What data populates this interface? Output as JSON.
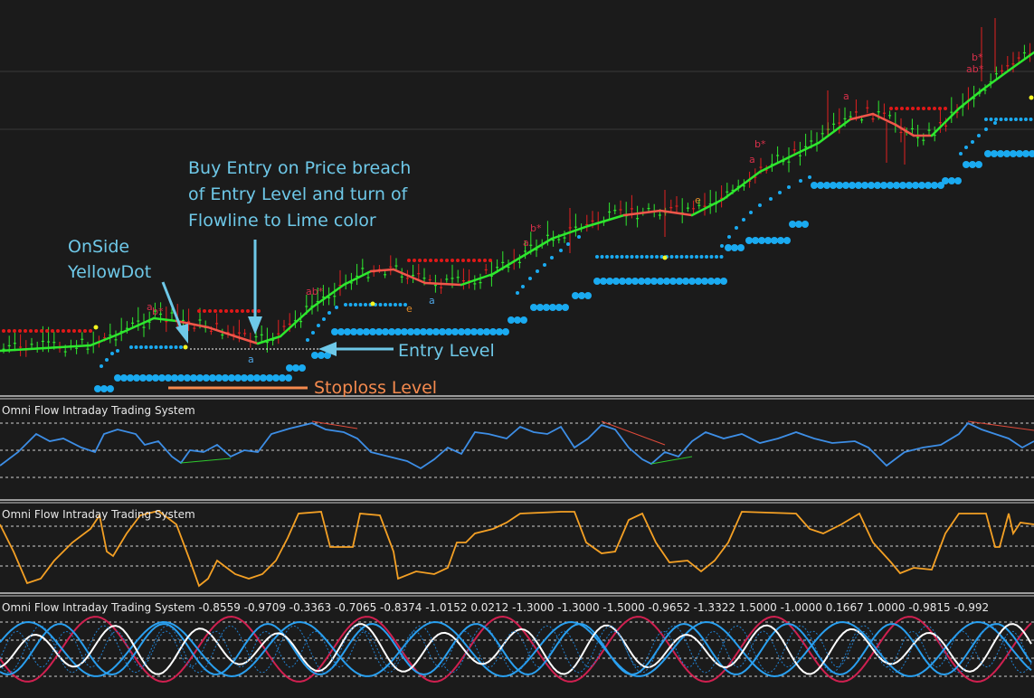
{
  "chart_data": [
    {
      "type": "line",
      "pane": "main",
      "annotations": {
        "buy_entry": [
          "Buy Entry on Price breach",
          "of Entry Level and turn of",
          "Flowline to Lime color"
        ],
        "onside": [
          "OnSide",
          "YellowDot"
        ],
        "entry_level": "Entry Level",
        "stoploss_level": "Stoploss Level"
      },
      "markers": [
        {
          "text": "a",
          "color": "#d8304a"
        },
        {
          "text": "b*",
          "color": "#d8304a"
        },
        {
          "text": "a",
          "color": "#4ea6e6"
        },
        {
          "text": "ab*",
          "color": "#d8304a"
        },
        {
          "text": "e",
          "color": "#e08a2a"
        },
        {
          "text": "a",
          "color": "#4ea6e6"
        },
        {
          "text": "a",
          "color": "#d8304a"
        },
        {
          "text": "b*",
          "color": "#d8304a"
        },
        {
          "text": "e",
          "color": "#e08a2a"
        },
        {
          "text": "a",
          "color": "#d8304a"
        },
        {
          "text": "b*",
          "color": "#d8304a"
        },
        {
          "text": "ab*",
          "color": "#d8304a"
        },
        {
          "text": "a",
          "color": "#d8304a"
        },
        {
          "text": "b*",
          "color": "#d8304a"
        }
      ],
      "colors": {
        "flowline_up": "#2ee82e",
        "flowline_down": "#f2564a",
        "entry_dots": "#1aaaf0",
        "resistance_dots": "#e01818",
        "onside_dot": "#f5f521",
        "candles_up": "#2ee82e",
        "candles_down": "#e02020"
      }
    },
    {
      "type": "line",
      "pane": "oscillator-1",
      "title": "Omni Flow Intraday Trading System",
      "colors": {
        "line": "#3d8ee6",
        "divergence_bear": "#e04a3a",
        "divergence_bull": "#2ec82e"
      }
    },
    {
      "type": "line",
      "pane": "oscillator-2",
      "title": "Omni Flow Intraday Trading System",
      "colors": {
        "line": "#f4a024"
      }
    },
    {
      "type": "line",
      "pane": "oscillator-3",
      "title": "Omni Flow Intraday Trading System -0.8559 -0.9709 -0.3363 -0.7065 -0.8374 -1.0152 0.0212 -1.3000 -1.3000 -1.5000 -0.9652 -1.3322 1.5000 -1.0000 0.1667 1.0000 -0.9815 -0.992",
      "colors": {
        "white": "#ffffff",
        "blue": "#2aa0f0",
        "red": "#d02050",
        "dotted": "#1f7fcf"
      }
    }
  ]
}
